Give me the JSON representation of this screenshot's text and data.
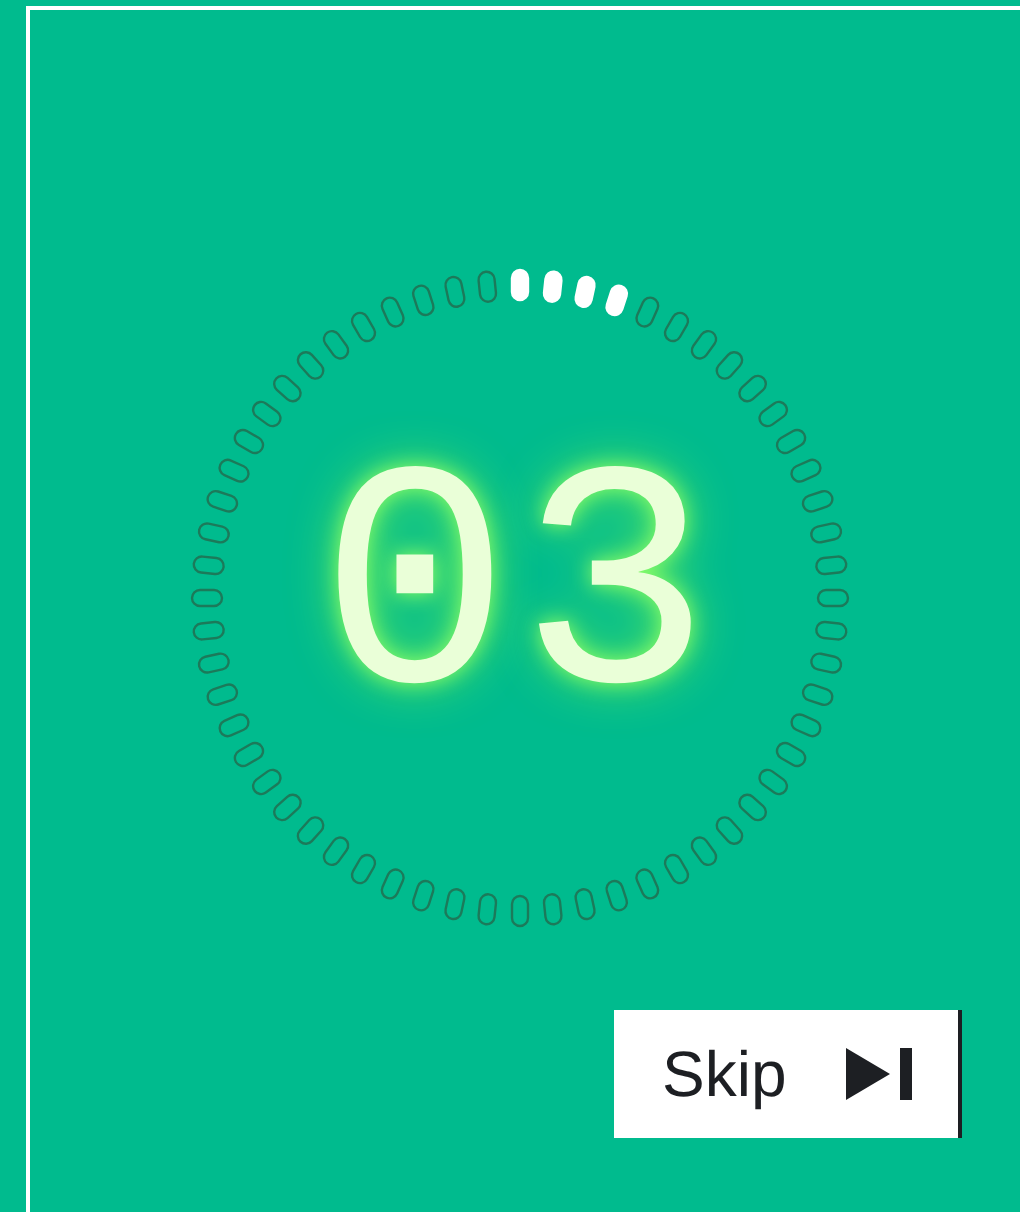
{
  "countdown": {
    "value": "03"
  },
  "skip_button": {
    "label": "Skip"
  }
}
